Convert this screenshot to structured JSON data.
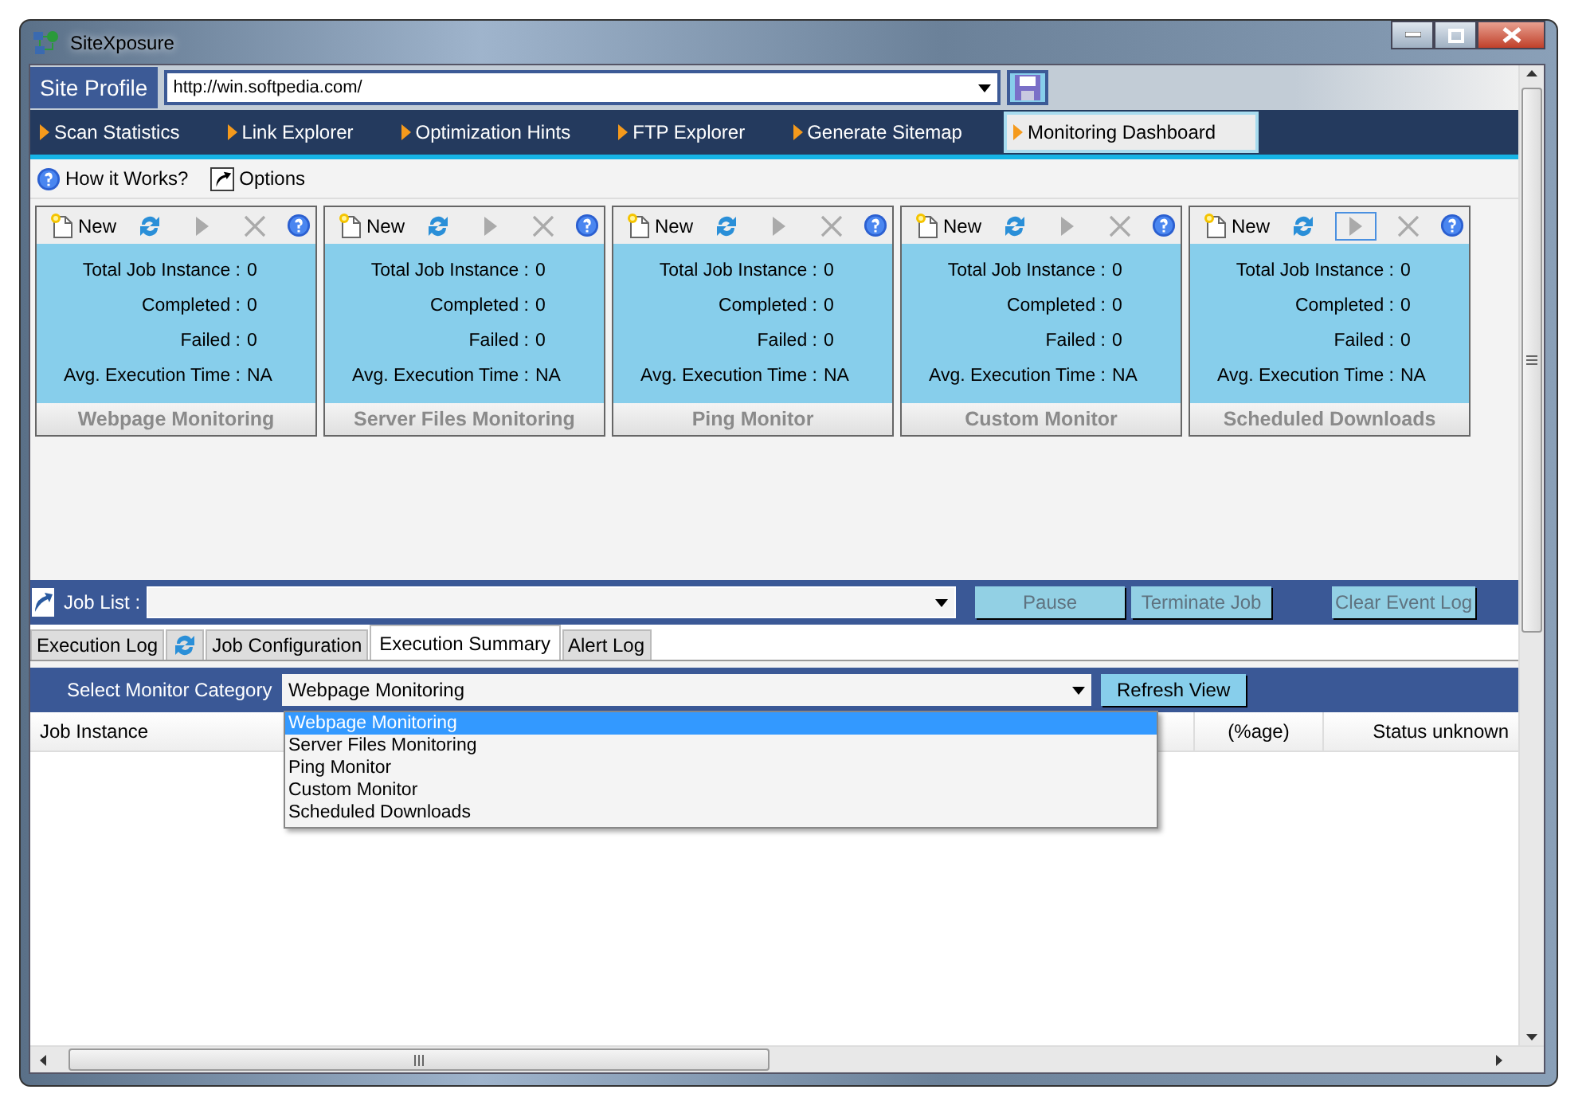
{
  "window": {
    "title": "SiteXposure"
  },
  "site_profile": {
    "label": "Site Profile",
    "url": "http://win.softpedia.com/"
  },
  "nav_tabs": [
    {
      "label": "Scan Statistics",
      "selected": false
    },
    {
      "label": "Link Explorer",
      "selected": false
    },
    {
      "label": "Optimization Hints",
      "selected": false
    },
    {
      "label": "FTP Explorer",
      "selected": false
    },
    {
      "label": "Generate Sitemap",
      "selected": false
    },
    {
      "label": "Monitoring Dashboard",
      "selected": true
    }
  ],
  "toolbar": [
    {
      "label": "How it Works?",
      "kind": "help"
    },
    {
      "label": "Options",
      "kind": "shortcut"
    }
  ],
  "monitors": [
    {
      "title": "Webpage Monitoring",
      "new_label": "New",
      "play_focused": false,
      "stats": [
        {
          "label": "Total Job Instance :",
          "value": "0"
        },
        {
          "label": "Completed :",
          "value": "0"
        },
        {
          "label": "Failed :",
          "value": "0"
        },
        {
          "label": "Avg. Execution Time :",
          "value": "NA"
        }
      ]
    },
    {
      "title": "Server Files Monitoring",
      "new_label": "New",
      "play_focused": false,
      "stats": [
        {
          "label": "Total Job Instance :",
          "value": "0"
        },
        {
          "label": "Completed :",
          "value": "0"
        },
        {
          "label": "Failed :",
          "value": "0"
        },
        {
          "label": "Avg. Execution Time :",
          "value": "NA"
        }
      ]
    },
    {
      "title": "Ping Monitor",
      "new_label": "New",
      "play_focused": false,
      "stats": [
        {
          "label": "Total Job Instance :",
          "value": "0"
        },
        {
          "label": "Completed :",
          "value": "0"
        },
        {
          "label": "Failed :",
          "value": "0"
        },
        {
          "label": "Avg. Execution Time :",
          "value": "NA"
        }
      ]
    },
    {
      "title": "Custom Monitor",
      "new_label": "New",
      "play_focused": false,
      "stats": [
        {
          "label": "Total Job Instance :",
          "value": "0"
        },
        {
          "label": "Completed :",
          "value": "0"
        },
        {
          "label": "Failed :",
          "value": "0"
        },
        {
          "label": "Avg. Execution Time :",
          "value": "NA"
        }
      ]
    },
    {
      "title": "Scheduled Downloads",
      "new_label": "New",
      "play_focused": true,
      "stats": [
        {
          "label": "Total Job Instance :",
          "value": "0"
        },
        {
          "label": "Completed :",
          "value": "0"
        },
        {
          "label": "Failed :",
          "value": "0"
        },
        {
          "label": "Avg. Execution Time :",
          "value": "NA"
        }
      ]
    }
  ],
  "job_list": {
    "label": "Job List :",
    "buttons": [
      {
        "label": "Pause",
        "disabled": true
      },
      {
        "label": "Terminate Job",
        "disabled": true
      },
      {
        "label": "Clear Event Log",
        "disabled": true
      }
    ]
  },
  "log_tabs": [
    {
      "label": "Execution Log",
      "selected": false
    },
    {
      "label": "Job Configuration",
      "selected": false
    },
    {
      "label": "Execution Summary",
      "selected": true
    },
    {
      "label": "Alert Log",
      "selected": false
    }
  ],
  "monitor_category": {
    "label": "Select Monitor Category",
    "value": "Webpage Monitoring",
    "button": "Refresh View",
    "options": [
      {
        "label": "Webpage Monitoring",
        "selected": true
      },
      {
        "label": "Server Files Monitoring",
        "selected": false
      },
      {
        "label": "Ping Monitor",
        "selected": false
      },
      {
        "label": "Custom Monitor",
        "selected": false
      },
      {
        "label": "Scheduled Downloads",
        "selected": false
      }
    ]
  },
  "table": {
    "columns": [
      "Job Instance",
      "(%age)",
      "Status unknown"
    ]
  }
}
